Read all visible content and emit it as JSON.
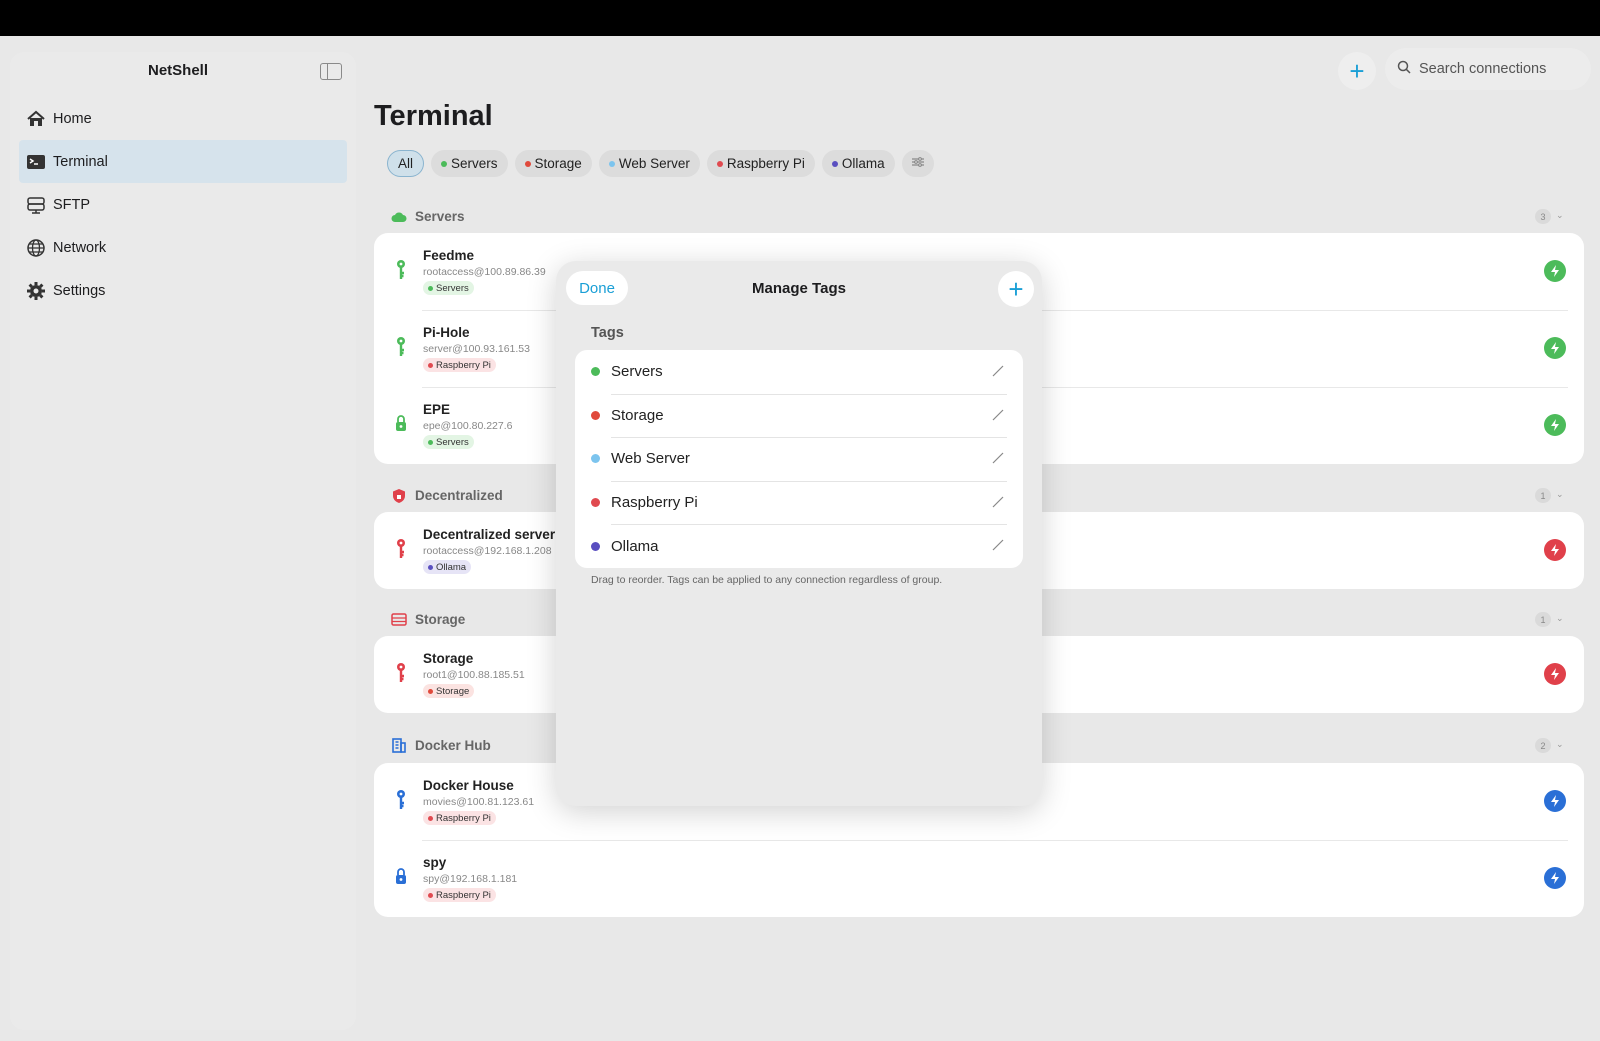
{
  "app": {
    "title": "NetShell"
  },
  "sidebar": {
    "items": [
      {
        "label": "Home",
        "icon": "home-icon"
      },
      {
        "label": "Terminal",
        "icon": "terminal-icon",
        "active": true
      },
      {
        "label": "SFTP",
        "icon": "sftp-icon"
      },
      {
        "label": "Network",
        "icon": "globe-icon"
      },
      {
        "label": "Settings",
        "icon": "gear-icon"
      }
    ]
  },
  "header": {
    "search_placeholder": "Search connections",
    "add_icon": "plus-icon"
  },
  "main": {
    "title": "Terminal",
    "filters": [
      {
        "label": "All",
        "color": ""
      },
      {
        "label": "Servers",
        "color": "#4cbb5a"
      },
      {
        "label": "Storage",
        "color": "#e04a3c"
      },
      {
        "label": "Web Server",
        "color": "#7cc4ee"
      },
      {
        "label": "Raspberry Pi",
        "color": "#e04a50"
      },
      {
        "label": "Ollama",
        "color": "#5a4fc0"
      }
    ],
    "groups": [
      {
        "name": "Servers",
        "count": "3",
        "icon": "cloud-icon",
        "color": "#4cbb5a",
        "connections": [
          {
            "name": "Feedme",
            "host": "rootaccess@100.89.86.39",
            "tag": "Servers",
            "tag_color": "#4cbb5a",
            "tag_bg": "#e3f5e4",
            "key_icon": "key-icon",
            "color": "#4cbb5a"
          },
          {
            "name": "Pi-Hole",
            "host": "server@100.93.161.53",
            "tag": "Raspberry Pi",
            "tag_color": "#e04a50",
            "tag_bg": "#fbe3e4",
            "key_icon": "key-icon",
            "color": "#4cbb5a"
          },
          {
            "name": "EPE",
            "host": "epe@100.80.227.6",
            "tag": "Servers",
            "tag_color": "#4cbb5a",
            "tag_bg": "#e3f5e4",
            "key_icon": "lock-icon",
            "color": "#4cbb5a"
          }
        ]
      },
      {
        "name": "Decentralized",
        "count": "1",
        "icon": "shield-icon",
        "color": "#e0404a",
        "connections": [
          {
            "name": "Decentralized server",
            "host": "rootaccess@192.168.1.208",
            "tag": "Ollama",
            "tag_color": "#5a4fc0",
            "tag_bg": "#e6e4f6",
            "key_icon": "key-icon",
            "color": "#e0404a"
          }
        ]
      },
      {
        "name": "Storage",
        "count": "1",
        "icon": "storage-icon",
        "color": "#e0404a",
        "connections": [
          {
            "name": "Storage",
            "host": "root1@100.88.185.51",
            "tag": "Storage",
            "tag_color": "#e04a3c",
            "tag_bg": "#fbe3e1",
            "key_icon": "key-icon",
            "color": "#e0404a"
          }
        ]
      },
      {
        "name": "Docker Hub",
        "count": "2",
        "icon": "building-icon",
        "color": "#2a6fd6",
        "connections": [
          {
            "name": "Docker House",
            "host": "movies@100.81.123.61",
            "tag": "Raspberry Pi",
            "tag_color": "#e04a50",
            "tag_bg": "#fbe3e4",
            "key_icon": "key-icon",
            "color": "#2a6fd6"
          },
          {
            "name": "spy",
            "host": "spy@192.168.1.181",
            "tag": "Raspberry Pi",
            "tag_color": "#e04a50",
            "tag_bg": "#fbe3e4",
            "key_icon": "lock-icon",
            "color": "#2a6fd6"
          }
        ]
      }
    ]
  },
  "modal": {
    "title": "Manage Tags",
    "done_label": "Done",
    "section_label": "Tags",
    "tags": [
      {
        "label": "Servers",
        "color": "#4cbb5a"
      },
      {
        "label": "Storage",
        "color": "#e04a3c"
      },
      {
        "label": "Web Server",
        "color": "#7cc4ee"
      },
      {
        "label": "Raspberry Pi",
        "color": "#e04a50"
      },
      {
        "label": "Ollama",
        "color": "#5a4fc0"
      }
    ],
    "hint": "Drag to reorder. Tags can be applied to any connection regardless of group."
  }
}
